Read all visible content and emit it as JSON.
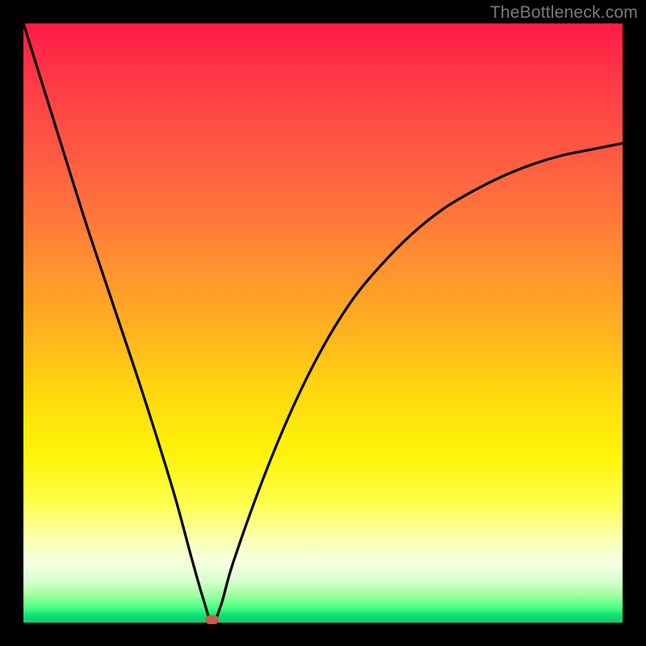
{
  "watermark": "TheBottleneck.com",
  "colors": {
    "frame": "#000000",
    "gradient_top": "#ff1a46",
    "gradient_mid": "#ffd90f",
    "gradient_bottom": "#08d06f",
    "curve": "#000000",
    "marker": "#c95c4d",
    "watermark_text": "#7b7b7b"
  },
  "chart_data": {
    "type": "line",
    "title": "",
    "xlabel": "",
    "ylabel": "",
    "xlim": [
      0,
      100
    ],
    "ylim": [
      0,
      100
    ],
    "series": [
      {
        "name": "bottleneck-curve",
        "x": [
          0,
          5,
          10,
          15,
          20,
          25,
          28,
          30,
          31.5,
          33,
          35,
          40,
          45,
          50,
          55,
          60,
          65,
          70,
          75,
          80,
          85,
          90,
          95,
          100
        ],
        "y": [
          100,
          84,
          68,
          53,
          38,
          22,
          11,
          4,
          0,
          3,
          10,
          24,
          36,
          46,
          54,
          60,
          65,
          69,
          72,
          74.5,
          76.5,
          78,
          79,
          80
        ]
      }
    ],
    "annotations": [
      {
        "name": "optimal-marker",
        "x": 31.5,
        "y": 0
      }
    ],
    "grid": false,
    "legend": false
  }
}
